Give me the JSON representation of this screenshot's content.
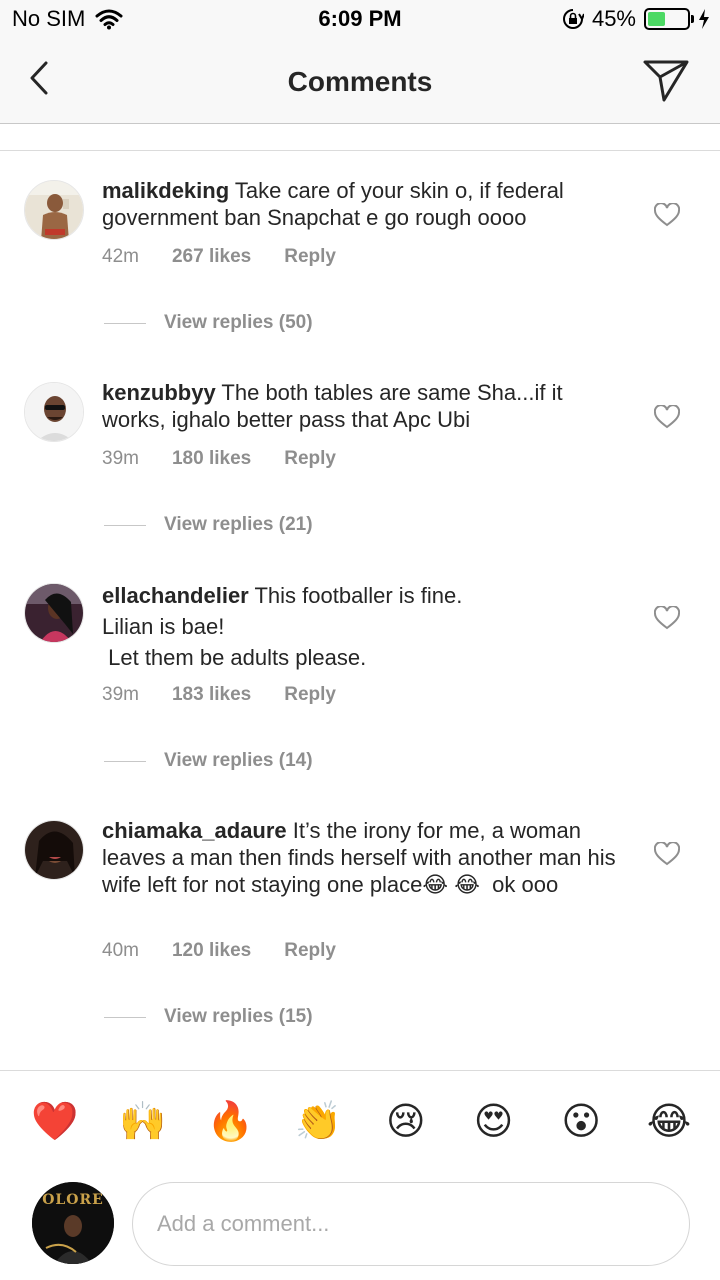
{
  "status_bar": {
    "carrier": "No SIM",
    "time": "6:09 PM",
    "battery_percent": "45%",
    "battery_level": 0.45,
    "icons": [
      "wifi-icon",
      "rotation-lock-icon",
      "battery-icon",
      "charging-bolt-icon"
    ]
  },
  "nav": {
    "title": "Comments",
    "back_icon": "chevron-left-icon",
    "send_icon": "paper-plane-icon"
  },
  "comments": [
    {
      "username": "malikdeking",
      "text": "Take care of your skin o, if federal government ban Snapchat e go rough oooo",
      "time": "42m",
      "likes": "267 likes",
      "reply": "Reply",
      "view_replies": "View replies (50)"
    },
    {
      "username": "kenzubbyy",
      "text": "The both tables are same Sha...if it works, ighalo better pass that Apc Ubi",
      "time": "39m",
      "likes": "180 likes",
      "reply": "Reply",
      "view_replies": "View replies (21)"
    },
    {
      "username": "ellachandelier",
      "text": "This footballer is fine.\nLilian is bae!\n Let them be adults please.",
      "time": "39m",
      "likes": "183 likes",
      "reply": "Reply",
      "view_replies": "View replies (14)"
    },
    {
      "username": "chiamaka_adaure",
      "text": "It’s the irony for me, a woman leaves a man then finds herself with another man his wife left for not staying one place😂 😂  ok ooo",
      "time": "40m",
      "likes": "120 likes",
      "reply": "Reply",
      "view_replies": "View replies (15)"
    }
  ],
  "emoji_bar": [
    "❤️",
    "🙌",
    "🔥",
    "👏",
    "😢",
    "😍",
    "😮",
    "😂"
  ],
  "composer": {
    "placeholder": "Add a comment...",
    "avatar_logo_text": "OLORE"
  }
}
